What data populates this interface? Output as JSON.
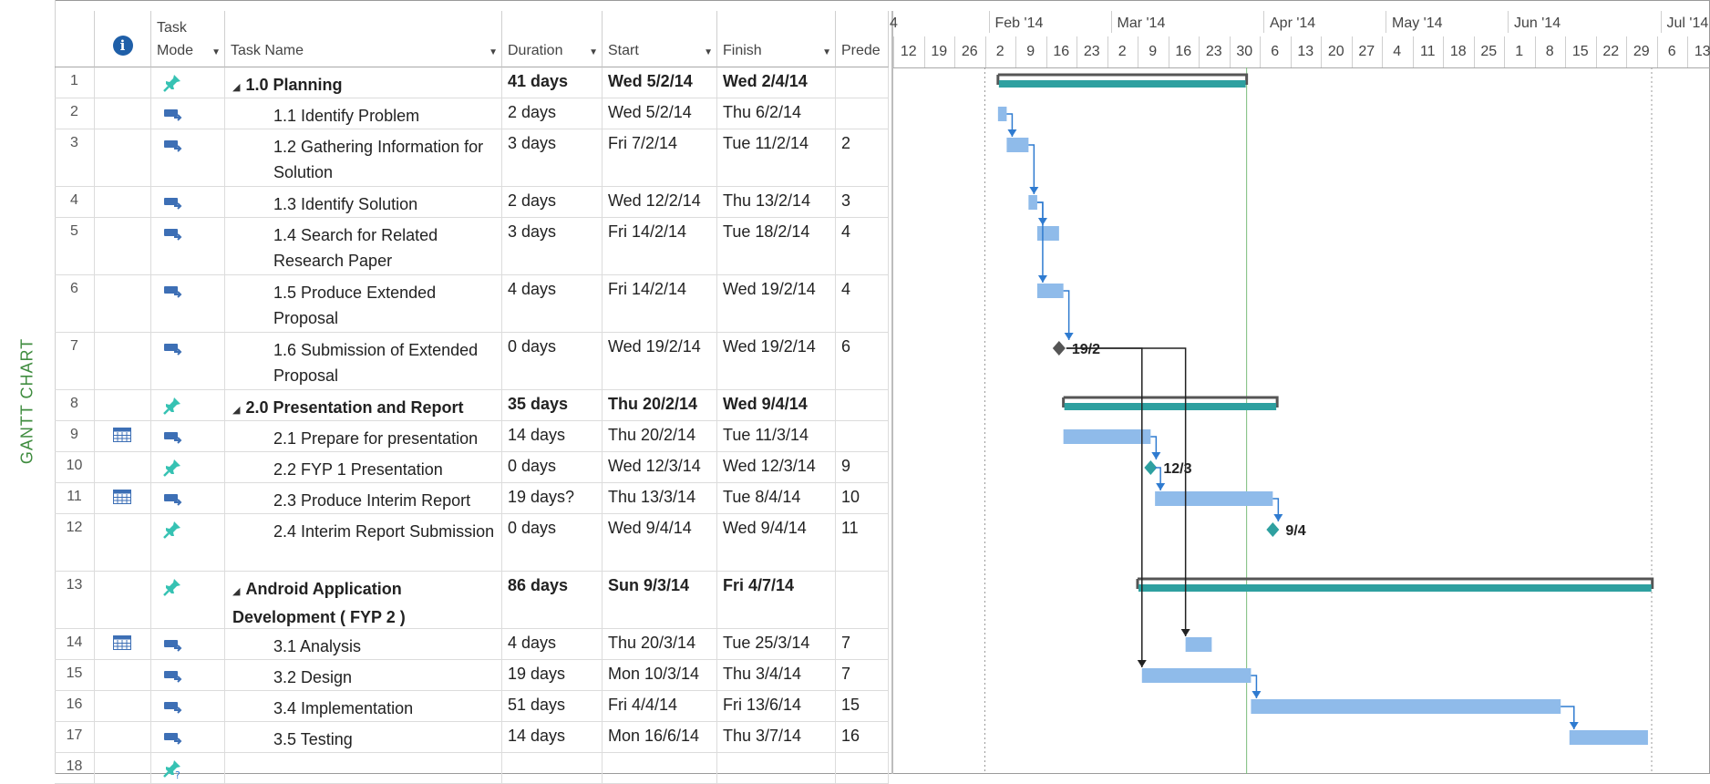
{
  "view_label": "GANTT CHART",
  "columns": {
    "info_icon": "info-icon",
    "task_mode_line1": "Task",
    "task_mode_line2": "Mode",
    "task_name": "Task Name",
    "duration": "Duration",
    "start": "Start",
    "finish": "Finish",
    "predecessors": "Prede"
  },
  "timeline": {
    "months": [
      "4",
      "Feb '14",
      "Mar '14",
      "Apr '14",
      "May '14",
      "Jun '14",
      "Jul '14"
    ],
    "days": [
      "12",
      "19",
      "26",
      "2",
      "9",
      "16",
      "23",
      "2",
      "9",
      "16",
      "23",
      "30",
      "6",
      "13",
      "20",
      "27",
      "4",
      "11",
      "18",
      "25",
      "1",
      "8",
      "15",
      "22",
      "29",
      "6",
      "13"
    ]
  },
  "colors": {
    "auto_bar": "#8fbbea",
    "summary_bar": "#2ea0a0",
    "milestone_auto": "#555555",
    "milestone_manual": "#2ea0a0",
    "link": "#2f7bd0",
    "pin_icon": "#36c2b3"
  },
  "tasks": [
    {
      "id": "1",
      "name": "1.0 Planning",
      "duration": "41 days",
      "start": "Wed 5/2/14",
      "finish": "Wed 2/4/14",
      "pred": "",
      "summary": true,
      "mode": "manual",
      "indicator": ""
    },
    {
      "id": "2",
      "name": "1.1 Identify Problem",
      "duration": "2 days",
      "start": "Wed 5/2/14",
      "finish": "Thu 6/2/14",
      "pred": "",
      "summary": false,
      "mode": "auto",
      "indicator": ""
    },
    {
      "id": "3",
      "name": "1.2 Gathering Information for Solution",
      "duration": "3 days",
      "start": "Fri 7/2/14",
      "finish": "Tue 11/2/14",
      "pred": "2",
      "summary": false,
      "mode": "auto",
      "indicator": ""
    },
    {
      "id": "4",
      "name": "1.3 Identify Solution",
      "duration": "2 days",
      "start": "Wed 12/2/14",
      "finish": "Thu 13/2/14",
      "pred": "3",
      "summary": false,
      "mode": "auto",
      "indicator": ""
    },
    {
      "id": "5",
      "name": "1.4 Search for Related Research Paper",
      "duration": "3 days",
      "start": "Fri 14/2/14",
      "finish": "Tue 18/2/14",
      "pred": "4",
      "summary": false,
      "mode": "auto",
      "indicator": ""
    },
    {
      "id": "6",
      "name": "1.5 Produce Extended Proposal",
      "duration": "4 days",
      "start": "Fri 14/2/14",
      "finish": "Wed 19/2/14",
      "pred": "4",
      "summary": false,
      "mode": "auto",
      "indicator": ""
    },
    {
      "id": "7",
      "name": "1.6 Submission of Extended Proposal",
      "duration": "0 days",
      "start": "Wed 19/2/14",
      "finish": "Wed 19/2/14",
      "pred": "6",
      "summary": false,
      "mode": "auto",
      "indicator": ""
    },
    {
      "id": "8",
      "name": "2.0 Presentation and Report",
      "duration": "35 days",
      "start": "Thu 20/2/14",
      "finish": "Wed 9/4/14",
      "pred": "",
      "summary": true,
      "mode": "manual",
      "indicator": ""
    },
    {
      "id": "9",
      "name": "2.1 Prepare for presentation",
      "duration": "14 days",
      "start": "Thu 20/2/14",
      "finish": "Tue 11/3/14",
      "pred": "",
      "summary": false,
      "mode": "auto",
      "indicator": "calendar-icon"
    },
    {
      "id": "10",
      "name": "2.2 FYP 1 Presentation",
      "duration": "0 days",
      "start": "Wed 12/3/14",
      "finish": "Wed 12/3/14",
      "pred": "9",
      "summary": false,
      "mode": "manual",
      "indicator": ""
    },
    {
      "id": "11",
      "name": "2.3 Produce Interim Report",
      "duration": "19 days?",
      "start": "Thu 13/3/14",
      "finish": "Tue 8/4/14",
      "pred": "10",
      "summary": false,
      "mode": "auto",
      "indicator": "calendar-icon"
    },
    {
      "id": "12",
      "name": "2.4 Interim Report Submission",
      "duration": "0 days",
      "start": "Wed 9/4/14",
      "finish": "Wed 9/4/14",
      "pred": "11",
      "summary": false,
      "mode": "manual",
      "indicator": ""
    },
    {
      "id": "13",
      "name": "Android Application Development ( FYP 2 )",
      "duration": "86 days",
      "start": "Sun 9/3/14",
      "finish": "Fri 4/7/14",
      "pred": "",
      "summary": true,
      "mode": "manual",
      "indicator": ""
    },
    {
      "id": "14",
      "name": "3.1 Analysis",
      "duration": "4 days",
      "start": "Thu 20/3/14",
      "finish": "Tue 25/3/14",
      "pred": "7",
      "summary": false,
      "mode": "auto",
      "indicator": "calendar-icon"
    },
    {
      "id": "15",
      "name": "3.2 Design",
      "duration": "19 days",
      "start": "Mon 10/3/14",
      "finish": "Thu 3/4/14",
      "pred": "7",
      "summary": false,
      "mode": "auto",
      "indicator": ""
    },
    {
      "id": "16",
      "name": "3.4 Implementation",
      "duration": "51 days",
      "start": "Fri 4/4/14",
      "finish": "Fri 13/6/14",
      "pred": "15",
      "summary": false,
      "mode": "auto",
      "indicator": ""
    },
    {
      "id": "17",
      "name": "3.5 Testing",
      "duration": "14 days",
      "start": "Mon 16/6/14",
      "finish": "Thu 3/7/14",
      "pred": "16",
      "summary": false,
      "mode": "auto",
      "indicator": ""
    },
    {
      "id": "18",
      "name": "",
      "duration": "",
      "start": "",
      "finish": "",
      "pred": "",
      "summary": false,
      "mode": "new",
      "indicator": ""
    }
  ],
  "milestone_labels": {
    "7": "19/2",
    "10": "12/3",
    "12": "9/4"
  }
}
